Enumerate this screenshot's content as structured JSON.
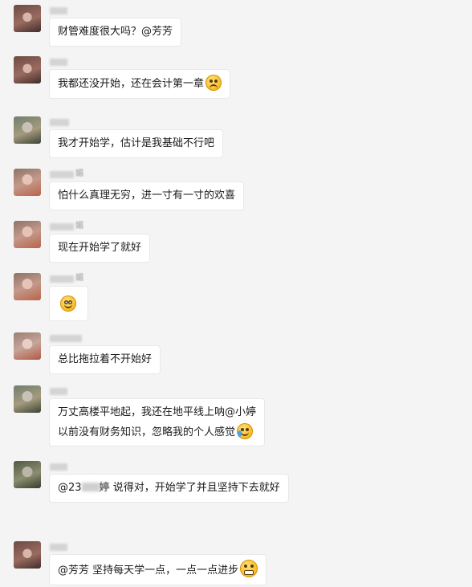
{
  "messages": [
    {
      "text": "财管难度很大吗？@芳芳",
      "emoji": ""
    },
    {
      "text": "我都还没开始，还在会计第一章",
      "emoji": "sad-face-icon"
    },
    {
      "text": "我才开始学，估计是我基础不行吧",
      "emoji": ""
    },
    {
      "text": "怕什么真理无穷，进一寸有一寸的欢喜",
      "emoji": ""
    },
    {
      "text": "现在开始学了就好",
      "emoji": ""
    },
    {
      "text": "",
      "emoji": "blushing-face-icon"
    },
    {
      "text": "总比拖拉着不开始好",
      "emoji": ""
    },
    {
      "line1": "万丈高楼平地起，我还在地平线上呐@小婷",
      "line2": "以前没有财务知识，忽略我的个人感觉",
      "emoji": "crying-laughing-icon"
    },
    {
      "prefix": "@23",
      "text": " 说得对，开始学了并且坚持下去就好",
      "emoji": ""
    },
    {
      "text": "@芳芳 坚持每天学一点，一点一点进步",
      "emoji": "grinning-face-icon"
    }
  ],
  "sender_names": {
    "m4_suffix": "媚",
    "m5_suffix": "媚",
    "m6_suffix": "媚",
    "m9_suffix": "婷"
  }
}
